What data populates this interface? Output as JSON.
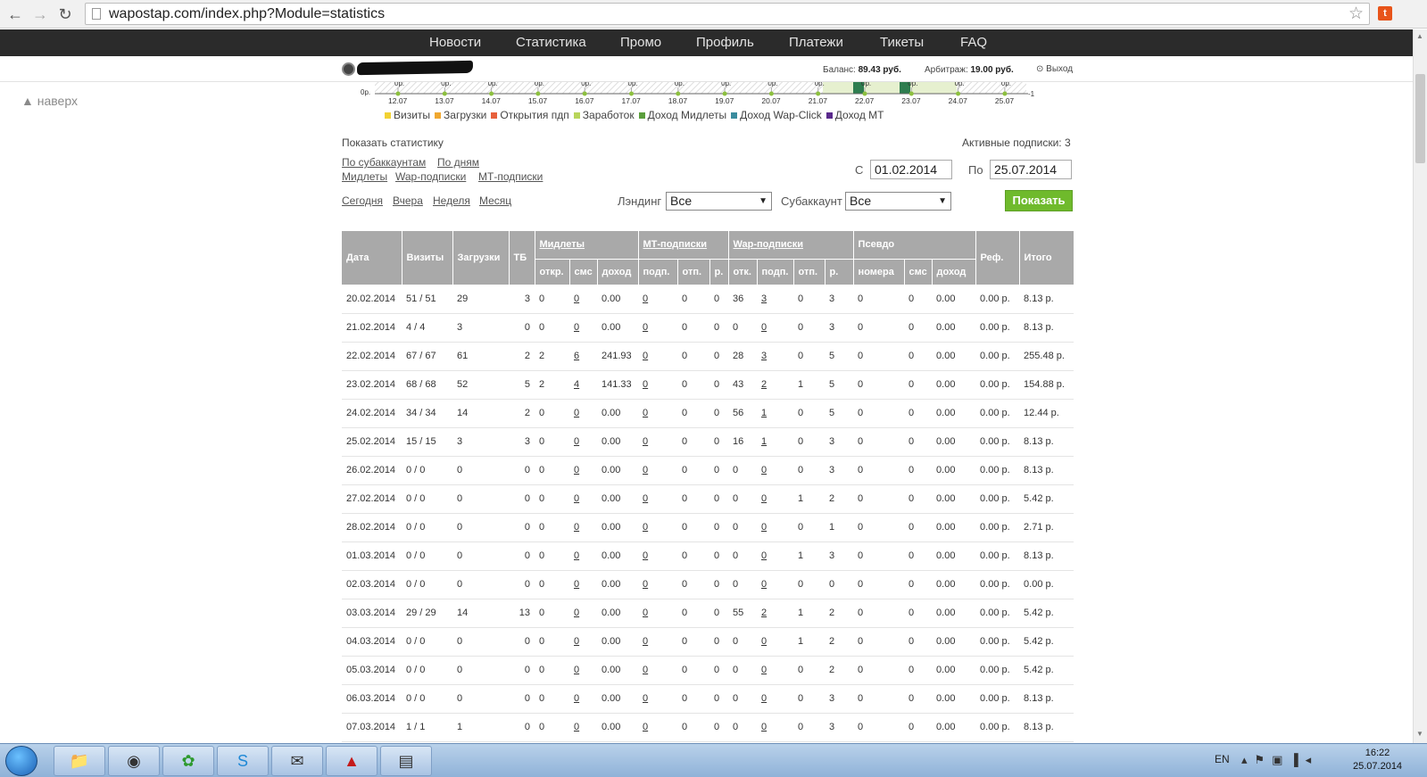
{
  "browser": {
    "url": "wapostap.com/index.php?Module=statistics"
  },
  "menu": [
    "Новости",
    "Статистика",
    "Промо",
    "Профиль",
    "Платежи",
    "Тикеты",
    "FAQ"
  ],
  "header": {
    "balance_label": "Баланс:",
    "balance_value": "89.43 руб.",
    "arb_label": "Арбитраж:",
    "arb_value": "19.00 руб.",
    "logout": "Выход"
  },
  "gotop": "▲ наверх",
  "chart_data": {
    "type": "bar",
    "categories": [
      "12.07",
      "13.07",
      "14.07",
      "15.07",
      "16.07",
      "17.07",
      "18.07",
      "19.07",
      "20.07",
      "21.07",
      "22.07",
      "23.07",
      "24.07",
      "25.07"
    ],
    "point_label": "0р.",
    "ylabel_left": "0р.",
    "ylabel_right": "-1"
  },
  "legend": [
    {
      "name": "Визиты",
      "color": "#f2d233"
    },
    {
      "name": "Загрузки",
      "color": "#f0a830"
    },
    {
      "name": "Открытия пдп",
      "color": "#e8603c"
    },
    {
      "name": "Заработок",
      "color": "#b9d55a"
    },
    {
      "name": "Доход Мидлеты",
      "color": "#5a9e3c"
    },
    {
      "name": "Доход Wap-Click",
      "color": "#3a8c9e"
    },
    {
      "name": "Доход MT",
      "color": "#5a2a8c"
    }
  ],
  "filters": {
    "show_stat": "Показать статистику",
    "active_subs": "Активные подписки: 3",
    "links1": [
      "По субаккаунтам",
      "По дням"
    ],
    "links2": [
      "Мидлеты",
      "Wap-подписки",
      "МТ-подписки"
    ],
    "periods": [
      "Сегодня",
      "Вчера",
      "Неделя",
      "Месяц"
    ],
    "from_label": "С",
    "from_value": "01.02.2014",
    "to_label": "По",
    "to_value": "25.07.2014",
    "landing_label": "Лэндинг",
    "landing_value": "Все",
    "sub_label": "Субаккаунт",
    "sub_value": "Все",
    "show_button": "Показать"
  },
  "table": {
    "h1": {
      "date": "Дата",
      "visits": "Визиты",
      "downloads": "Загрузки",
      "tb": "ТБ",
      "midlets": "Мидлеты",
      "mt": "МТ-подписки",
      "wap": "Wap-подписки",
      "pseudo": "Псевдо",
      "ref": "Реф.",
      "total": "Итого"
    },
    "h2": [
      "откр.",
      "смс",
      "доход",
      "подп.",
      "отп.",
      "р.",
      "отк.",
      "подп.",
      "отп.",
      "р.",
      "номера",
      "смс",
      "доход"
    ],
    "rows": [
      [
        "20.02.2014",
        "51 / 51",
        "29",
        "3",
        "0",
        "0",
        "0.00",
        "0",
        "0",
        "0",
        "36",
        "3",
        "0",
        "3",
        "0",
        "0",
        "0.00",
        "0.00 р.",
        "8.13 р."
      ],
      [
        "21.02.2014",
        "4 / 4",
        "3",
        "0",
        "0",
        "0",
        "0.00",
        "0",
        "0",
        "0",
        "0",
        "0",
        "0",
        "3",
        "0",
        "0",
        "0.00",
        "0.00 р.",
        "8.13 р."
      ],
      [
        "22.02.2014",
        "67 / 67",
        "61",
        "2",
        "2",
        "6",
        "241.93",
        "0",
        "0",
        "0",
        "28",
        "3",
        "0",
        "5",
        "0",
        "0",
        "0.00",
        "0.00 р.",
        "255.48 р."
      ],
      [
        "23.02.2014",
        "68 / 68",
        "52",
        "5",
        "2",
        "4",
        "141.33",
        "0",
        "0",
        "0",
        "43",
        "2",
        "1",
        "5",
        "0",
        "0",
        "0.00",
        "0.00 р.",
        "154.88 р."
      ],
      [
        "24.02.2014",
        "34 / 34",
        "14",
        "2",
        "0",
        "0",
        "0.00",
        "0",
        "0",
        "0",
        "56",
        "1",
        "0",
        "5",
        "0",
        "0",
        "0.00",
        "0.00 р.",
        "12.44 р."
      ],
      [
        "25.02.2014",
        "15 / 15",
        "3",
        "3",
        "0",
        "0",
        "0.00",
        "0",
        "0",
        "0",
        "16",
        "1",
        "0",
        "3",
        "0",
        "0",
        "0.00",
        "0.00 р.",
        "8.13 р."
      ],
      [
        "26.02.2014",
        "0 / 0",
        "0",
        "0",
        "0",
        "0",
        "0.00",
        "0",
        "0",
        "0",
        "0",
        "0",
        "0",
        "3",
        "0",
        "0",
        "0.00",
        "0.00 р.",
        "8.13 р."
      ],
      [
        "27.02.2014",
        "0 / 0",
        "0",
        "0",
        "0",
        "0",
        "0.00",
        "0",
        "0",
        "0",
        "0",
        "0",
        "1",
        "2",
        "0",
        "0",
        "0.00",
        "0.00 р.",
        "5.42 р."
      ],
      [
        "28.02.2014",
        "0 / 0",
        "0",
        "0",
        "0",
        "0",
        "0.00",
        "0",
        "0",
        "0",
        "0",
        "0",
        "0",
        "1",
        "0",
        "0",
        "0.00",
        "0.00 р.",
        "2.71 р."
      ],
      [
        "01.03.2014",
        "0 / 0",
        "0",
        "0",
        "0",
        "0",
        "0.00",
        "0",
        "0",
        "0",
        "0",
        "0",
        "1",
        "3",
        "0",
        "0",
        "0.00",
        "0.00 р.",
        "8.13 р."
      ],
      [
        "02.03.2014",
        "0 / 0",
        "0",
        "0",
        "0",
        "0",
        "0.00",
        "0",
        "0",
        "0",
        "0",
        "0",
        "0",
        "0",
        "0",
        "0",
        "0.00",
        "0.00 р.",
        "0.00 р."
      ],
      [
        "03.03.2014",
        "29 / 29",
        "14",
        "13",
        "0",
        "0",
        "0.00",
        "0",
        "0",
        "0",
        "55",
        "2",
        "1",
        "2",
        "0",
        "0",
        "0.00",
        "0.00 р.",
        "5.42 р."
      ],
      [
        "04.03.2014",
        "0 / 0",
        "0",
        "0",
        "0",
        "0",
        "0.00",
        "0",
        "0",
        "0",
        "0",
        "0",
        "1",
        "2",
        "0",
        "0",
        "0.00",
        "0.00 р.",
        "5.42 р."
      ],
      [
        "05.03.2014",
        "0 / 0",
        "0",
        "0",
        "0",
        "0",
        "0.00",
        "0",
        "0",
        "0",
        "0",
        "0",
        "0",
        "2",
        "0",
        "0",
        "0.00",
        "0.00 р.",
        "5.42 р."
      ],
      [
        "06.03.2014",
        "0 / 0",
        "0",
        "0",
        "0",
        "0",
        "0.00",
        "0",
        "0",
        "0",
        "0",
        "0",
        "0",
        "3",
        "0",
        "0",
        "0.00",
        "0.00 р.",
        "8.13 р."
      ],
      [
        "07.03.2014",
        "1 / 1",
        "1",
        "0",
        "0",
        "0",
        "0.00",
        "0",
        "0",
        "0",
        "0",
        "0",
        "0",
        "3",
        "0",
        "0",
        "0.00",
        "0.00 р.",
        "8.13 р."
      ]
    ]
  },
  "taskbar": {
    "lang": "EN",
    "time": "16:22",
    "date": "25.07.2014"
  }
}
